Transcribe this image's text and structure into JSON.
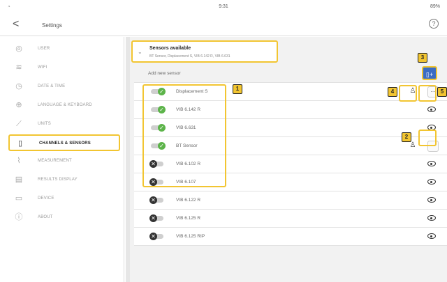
{
  "statusbar": {
    "time": "9:31",
    "battery": "89%",
    "wifi_icon": "wifi-icon"
  },
  "titlebar": {
    "back": "<",
    "title": "Settings",
    "help": "?"
  },
  "sidebar": {
    "items": [
      {
        "label": "USER",
        "icon": "user-icon"
      },
      {
        "label": "WIFI",
        "icon": "wifi-icon"
      },
      {
        "label": "DATE & TIME",
        "icon": "clock-icon"
      },
      {
        "label": "LANGUAGE & KEYBOARD",
        "icon": "globe-icon"
      },
      {
        "label": "UNITS",
        "icon": "ruler-icon"
      },
      {
        "label": "CHANNELS & SENSORS",
        "icon": "sensor-icon"
      },
      {
        "label": "MEASUREMENT",
        "icon": "measurement-icon"
      },
      {
        "label": "RESULTS DISPLAY",
        "icon": "chart-icon"
      },
      {
        "label": "DEVICE",
        "icon": "device-icon"
      },
      {
        "label": "ABOUT",
        "icon": "info-icon"
      }
    ]
  },
  "sensors": {
    "title": "Sensors available",
    "subtitle": "BT Sensor, Displacement S, VIB 6.142 R, VIB 6.631",
    "add_label": "Add new sensor",
    "add_icon": "▯+",
    "list": [
      {
        "name": "Displacement S"
      },
      {
        "name": "VIB 6.142 R"
      },
      {
        "name": "VIB 6.631"
      },
      {
        "name": "BT Sensor"
      },
      {
        "name": "VIB 6.102 R"
      },
      {
        "name": "VIB 6.107"
      },
      {
        "name": "VIB 6.122 R"
      },
      {
        "name": "VIB 6.125 R"
      },
      {
        "name": "VIB 6.125 RIP"
      }
    ]
  },
  "callouts": [
    "1",
    "2",
    "3",
    "4",
    "5"
  ],
  "colors": {
    "highlight": "#f2c531",
    "toggle_on": "#5db44a",
    "add_button": "#3b6cc4"
  }
}
